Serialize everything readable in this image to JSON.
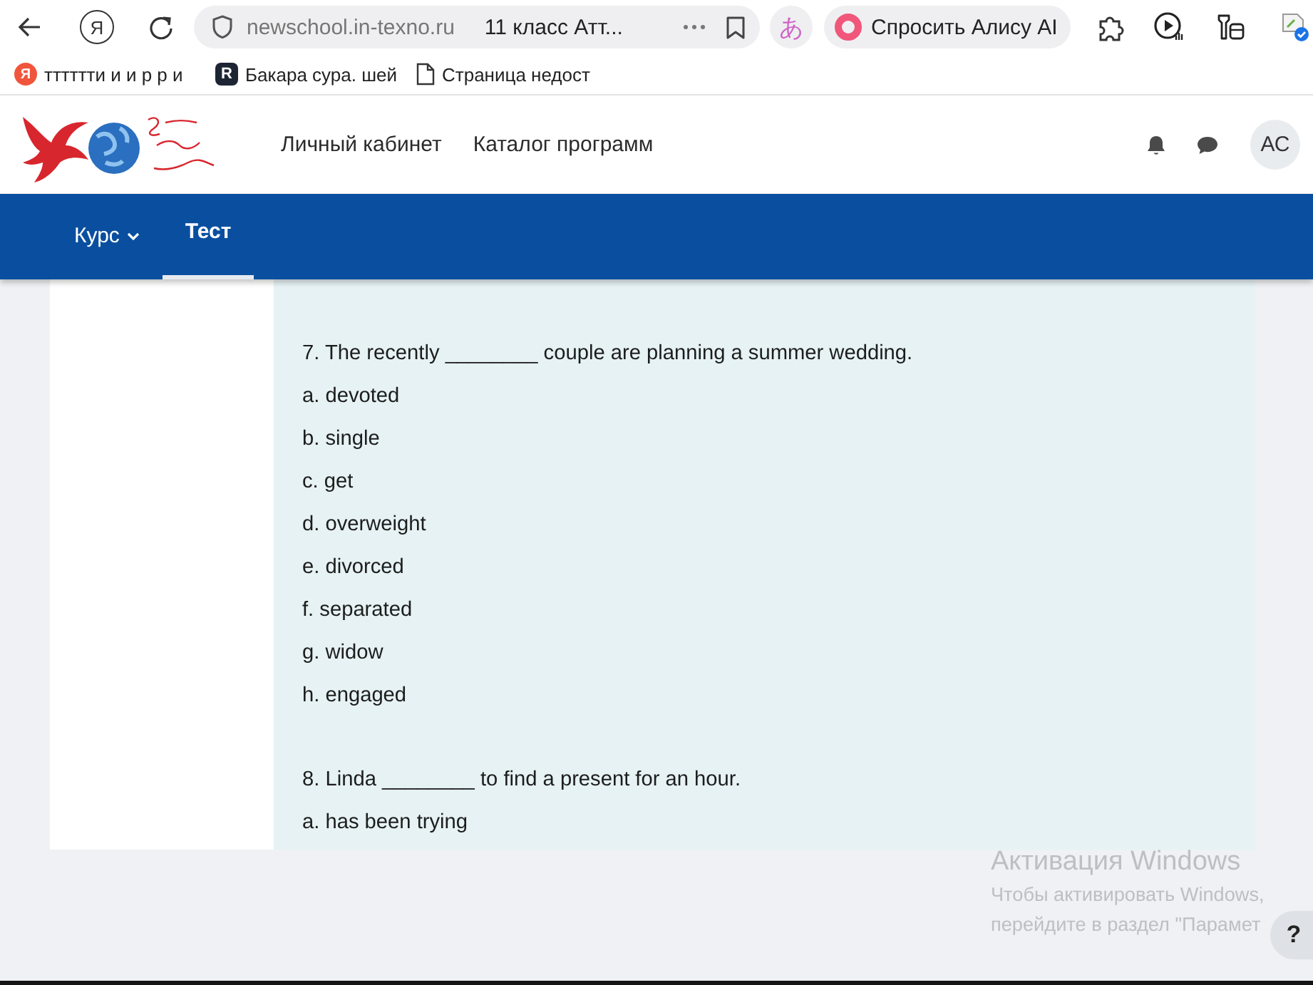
{
  "browser": {
    "home_glyph": "Я",
    "url": "newschool.in-texno.ru",
    "tab_title": "11 класс Атт...",
    "translate_glyph": "あ",
    "alice_label": "Спросить Алису AI"
  },
  "bookmarks": [
    {
      "kind": "yandex",
      "glyph": "Я",
      "label": "тттттти и и р р и"
    },
    {
      "kind": "letter",
      "glyph": "R",
      "label": "Бакара сура. шей"
    },
    {
      "kind": "page",
      "label": "Страница недост"
    }
  ],
  "site_header": {
    "nav": [
      "Личный кабинет",
      "Каталог программ"
    ],
    "avatar": "АС"
  },
  "course_nav": [
    {
      "label": "Курс",
      "kind": "menu",
      "selected": false
    },
    {
      "label": "Тест",
      "kind": "link",
      "selected": true
    }
  ],
  "questions": [
    {
      "prompt": "7. The recently ________ couple are planning a summer wedding.",
      "options": [
        "a. devoted",
        "b. single",
        "c. get",
        "d. overweight",
        "e. divorced",
        "f. separated",
        "g. widow",
        "h. engaged"
      ]
    },
    {
      "prompt": "8. Linda ________ to find a present for an hour.",
      "options": [
        "a. has been trying"
      ]
    }
  ],
  "windows_activation": {
    "title": "Активация Windows",
    "lines": [
      "Чтобы активировать Windows,",
      "перейдите в раздел \"Парамет"
    ]
  },
  "help_button": "?"
}
